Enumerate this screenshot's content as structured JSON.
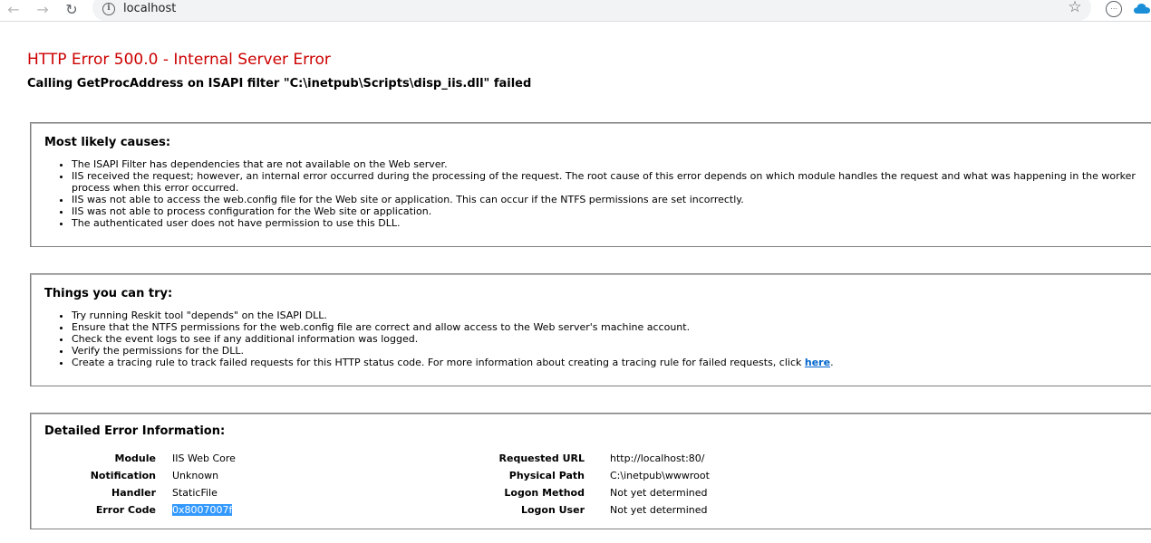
{
  "browser": {
    "url": "localhost",
    "back_icon": "back-arrow-icon",
    "forward_icon": "forward-arrow-icon",
    "reload_icon": "reload-icon"
  },
  "error": {
    "title": "HTTP Error 500.0 - Internal Server Error",
    "subtitle": "Calling GetProcAddress on ISAPI filter \"C:\\inetpub\\Scripts\\disp_iis.dll\" failed"
  },
  "causes": {
    "heading": "Most likely causes:",
    "items": [
      "The ISAPI Filter has dependencies that are not available on the Web server.",
      "IIS received the request; however, an internal error occurred during the processing of the request. The root cause of this error depends on which module handles the request and what was happening in the worker process when this error occurred.",
      "IIS was not able to access the web.config file for the Web site or application. This can occur if the NTFS permissions are set incorrectly.",
      "IIS was not able to process configuration for the Web site or application.",
      "The authenticated user does not have permission to use this DLL."
    ]
  },
  "try": {
    "heading": "Things you can try:",
    "items": [
      "Try running Reskit tool \"depends\" on the ISAPI DLL.",
      "Ensure that the NTFS permissions for the web.config file are correct and allow access to the Web server's machine account.",
      "Check the event logs to see if any additional information was logged.",
      "Verify the permissions for the DLL."
    ],
    "last_item_prefix": "Create a tracing rule to track failed requests for this HTTP status code. For more information about creating a tracing rule for failed requests, click ",
    "link_text": "here",
    "last_item_suffix": "."
  },
  "details": {
    "heading": "Detailed Error Information:",
    "rows": [
      {
        "k1": "Module",
        "v1": "IIS Web Core",
        "k2": "Requested URL",
        "v2": "http://localhost:80/"
      },
      {
        "k1": "Notification",
        "v1": "Unknown",
        "k2": "Physical Path",
        "v2": "C:\\inetpub\\wwwroot"
      },
      {
        "k1": "Handler",
        "v1": "StaticFile",
        "k2": "Logon Method",
        "v2": "Not yet determined"
      },
      {
        "k1": "Error Code",
        "v1": "0x8007007f",
        "k2": "Logon User",
        "v2": "Not yet determined"
      }
    ]
  }
}
